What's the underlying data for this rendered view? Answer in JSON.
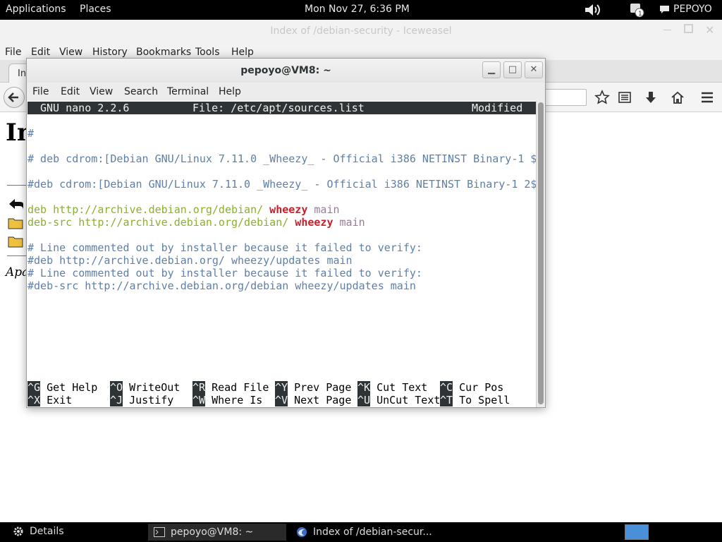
{
  "top_panel": {
    "applications": "Applications",
    "places": "Places",
    "clock": "Mon Nov 27,  6:36 PM",
    "user": "PEPOYO",
    "icons": [
      "volume-icon",
      "notification-icon",
      "chat-icon"
    ]
  },
  "browser": {
    "title": "Index of /debian-security - Iceweasel",
    "menu": [
      "File",
      "Edit",
      "View",
      "History",
      "Bookmarks",
      "Tools",
      "Help"
    ],
    "tab_label": "In",
    "page_heading": "In",
    "footer": "Apa"
  },
  "terminal": {
    "title": "pepoyo@VM8: ~",
    "menu": [
      "File",
      "Edit",
      "View",
      "Search",
      "Terminal",
      "Help"
    ],
    "nano_header": {
      "version": "GNU nano 2.2.6",
      "file": "File: /etc/apt/sources.list",
      "status": "Modified"
    },
    "lines": {
      "l1": "#",
      "l2": "# deb cdrom:[Debian GNU/Linux 7.11.0 _Wheezy_ - Official i386 NETINST Binary-1 $",
      "l3": "#deb cdrom:[Debian GNU/Linux 7.11.0 _Wheezy_ - Official i386 NETINST Binary-1 2$",
      "l4_type": "deb",
      "l4_url": "http://archive.debian.org/debian/",
      "l4_suite": "wheezy",
      "l4_comp": "main",
      "l5_type": "deb-src",
      "l5_url": "http://archive.debian.org/debian/",
      "l5_suite": "wheezy",
      "l5_comp": "main",
      "l6": "# Line commented out by installer because it failed to verify:",
      "l7": "#deb http://archive.debian.org/ wheezy/updates main",
      "l8": "# Line commented out by installer because it failed to verify:",
      "l9": "#deb-src http://archive.debian.org/debian wheezy/updates main"
    },
    "shortcuts": [
      {
        "key": "^G",
        "label": "Get Help"
      },
      {
        "key": "^O",
        "label": "WriteOut"
      },
      {
        "key": "^R",
        "label": "Read File"
      },
      {
        "key": "^Y",
        "label": "Prev Page"
      },
      {
        "key": "^K",
        "label": "Cut Text"
      },
      {
        "key": "^C",
        "label": "Cur Pos"
      },
      {
        "key": "^X",
        "label": "Exit"
      },
      {
        "key": "^J",
        "label": "Justify"
      },
      {
        "key": "^W",
        "label": "Where Is"
      },
      {
        "key": "^V",
        "label": "Next Page"
      },
      {
        "key": "^U",
        "label": "UnCut Text"
      },
      {
        "key": "^T",
        "label": "To Spell"
      }
    ]
  },
  "taskbar": {
    "details": "Details",
    "terminal_task": "pepoyo@VM8: ~",
    "browser_task": "Index of /debian-secur..."
  }
}
